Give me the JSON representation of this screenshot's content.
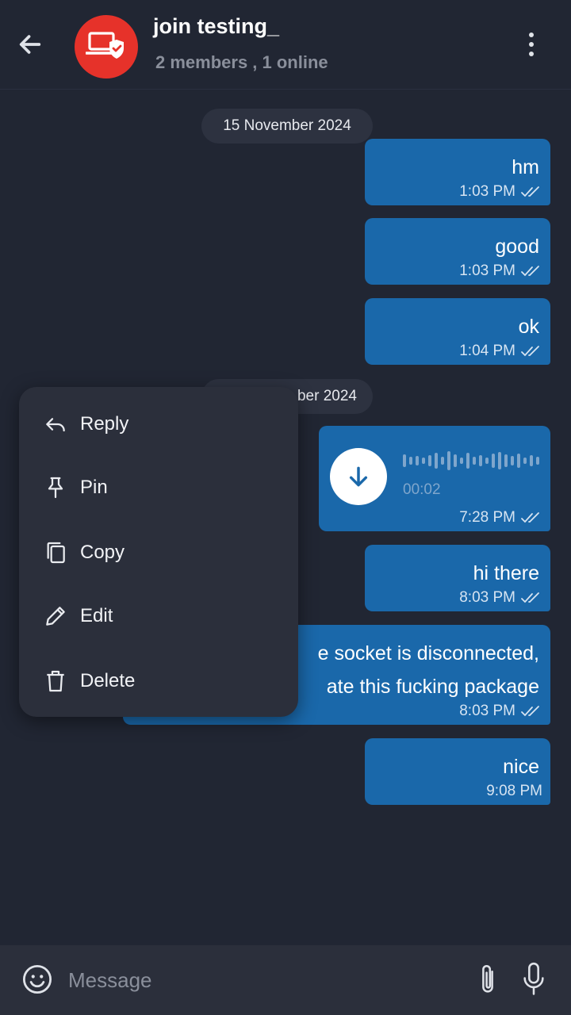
{
  "header": {
    "title": "join testing_",
    "subtitle": "2 members , 1 online",
    "avatar_color": "#e6322a"
  },
  "dates": [
    {
      "label": "15 November 2024"
    },
    {
      "label": "ber 2024"
    }
  ],
  "messages": [
    {
      "text": "hm",
      "time": "1:03 PM"
    },
    {
      "text": "good",
      "time": "1:03 PM"
    },
    {
      "text": "ok",
      "time": "1:04 PM"
    },
    {
      "type": "voice",
      "duration": "00:02",
      "time": "7:28 PM"
    },
    {
      "text": "hi there",
      "time": "8:03 PM"
    },
    {
      "line1": "e socket is disconnected,",
      "line2": "ate this fucking package",
      "time": "8:03 PM"
    },
    {
      "text": "nice",
      "time": "9:08 PM"
    }
  ],
  "context_menu": {
    "items": [
      {
        "label": "Reply",
        "icon": "reply-icon"
      },
      {
        "label": "Pin",
        "icon": "pin-icon"
      },
      {
        "label": "Copy",
        "icon": "copy-icon"
      },
      {
        "label": "Edit",
        "icon": "edit-icon"
      },
      {
        "label": "Delete",
        "icon": "delete-icon"
      }
    ]
  },
  "input": {
    "placeholder": "Message",
    "value": ""
  },
  "colors": {
    "background": "#212633",
    "bubble": "#1a68aa",
    "menu": "#2b2f3b"
  }
}
